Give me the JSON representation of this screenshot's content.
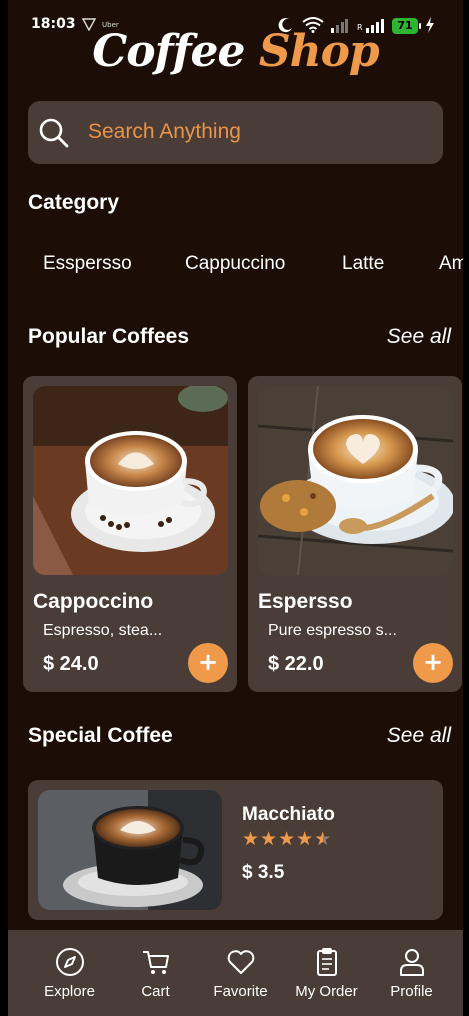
{
  "status_bar": {
    "time": "18:03",
    "app_badge": "Uber",
    "signal_label": "R",
    "battery": "71"
  },
  "logo": {
    "part1": "Coffee ",
    "part2": "Shop"
  },
  "search": {
    "placeholder": "Search Anything"
  },
  "category": {
    "title": "Category",
    "items": [
      "Esspersso",
      "Cappuccino",
      "Latte",
      "Am"
    ]
  },
  "popular": {
    "title": "Popular Coffees",
    "see_all": "See all",
    "items": [
      {
        "name": "Cappoccino",
        "desc": "Espresso, stea...",
        "price": "$ 24.0",
        "add": "+"
      },
      {
        "name": "Espersso",
        "desc": "Pure espresso s...",
        "price": "$ 22.0",
        "add": "+"
      }
    ]
  },
  "special": {
    "title": "Special Coffee",
    "see_all": "See all",
    "item": {
      "name": "Macchiato",
      "rating": 4.5,
      "stars": "★★★★★",
      "price": "$ 3.5"
    }
  },
  "nav": {
    "items": [
      {
        "label": "Explore",
        "icon": "compass-icon"
      },
      {
        "label": "Cart",
        "icon": "cart-icon"
      },
      {
        "label": "Favorite",
        "icon": "heart-icon"
      },
      {
        "label": "My Order",
        "icon": "clipboard-icon"
      },
      {
        "label": "Profile",
        "icon": "person-icon"
      }
    ]
  },
  "colors": {
    "background": "#1c0e07",
    "surface": "#4a3c36",
    "accent": "#ef9a4a"
  }
}
